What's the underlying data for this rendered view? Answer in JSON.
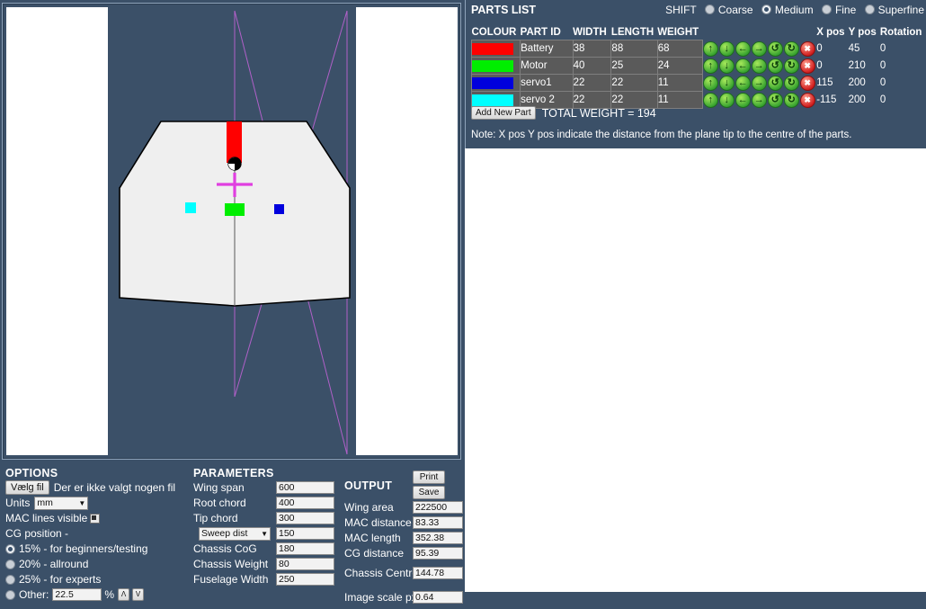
{
  "options": {
    "title": "OPTIONS",
    "file_button": "Vælg fil",
    "file_status": "Der er ikke valgt nogen fil",
    "units_label": "Units",
    "units_value": "mm",
    "mac_lines_label": "MAC lines visible",
    "cg_position_label": "CG position -",
    "cg_choices": [
      {
        "label": "15% - for beginners/testing",
        "selected": true
      },
      {
        "label": "20% - allround",
        "selected": false
      },
      {
        "label": "25% - for experts",
        "selected": false
      }
    ],
    "other_label": "Other:",
    "other_value": "22.5",
    "percent_sign": "%",
    "step_up": "Λ",
    "step_down": "V"
  },
  "parameters": {
    "title": "PARAMETERS",
    "rows": [
      {
        "label": "Wing span",
        "value": "600"
      },
      {
        "label": "Root chord",
        "value": "400"
      },
      {
        "label": "Tip chord",
        "value": "300"
      },
      {
        "label": "Sweep dist",
        "value": "150",
        "is_select": true
      },
      {
        "label": "Chassis CoG",
        "value": "180"
      },
      {
        "label": "Chassis Weight",
        "value": "80"
      },
      {
        "label": "Fuselage Width",
        "value": "250"
      }
    ]
  },
  "output": {
    "title": "OUTPUT",
    "print_label": "Print",
    "save_label": "Save",
    "rows": [
      {
        "label": "Wing area",
        "value": "222500"
      },
      {
        "label": "MAC distance",
        "value": "83.33"
      },
      {
        "label": "MAC length",
        "value": "352.38"
      },
      {
        "label": "CG distance",
        "value": "95.39"
      },
      {
        "label": "Chassis Centroid",
        "value": "144.78"
      },
      {
        "label": "Image scale px/unit",
        "value": "0.64"
      }
    ]
  },
  "parts_panel": {
    "title": "PARTS LIST",
    "shift_label": "SHIFT",
    "shift_options": [
      {
        "label": "Coarse",
        "selected": false
      },
      {
        "label": "Medium",
        "selected": true
      },
      {
        "label": "Fine",
        "selected": false
      },
      {
        "label": "Superfine",
        "selected": false
      }
    ],
    "columns": [
      "COLOUR",
      "PART ID",
      "WIDTH",
      "LENGTH",
      "WEIGHT",
      "X pos",
      "Y pos",
      "Rotation"
    ],
    "rows": [
      {
        "colour": "#ff0000",
        "part_id": "Battery",
        "width": "38",
        "length": "88",
        "weight": "68",
        "x_pos": "0",
        "y_pos": "45",
        "rotation": "0"
      },
      {
        "colour": "#00ee00",
        "part_id": "Motor",
        "width": "40",
        "length": "25",
        "weight": "24",
        "x_pos": "0",
        "y_pos": "210",
        "rotation": "0"
      },
      {
        "colour": "#0000dd",
        "part_id": "servo1",
        "width": "22",
        "length": "22",
        "weight": "11",
        "x_pos": "115",
        "y_pos": "200",
        "rotation": "0"
      },
      {
        "colour": "#00ffff",
        "part_id": "servo 2",
        "width": "22",
        "length": "22",
        "weight": "11",
        "x_pos": "-115",
        "y_pos": "200",
        "rotation": "0"
      }
    ],
    "row_icons": [
      "move-up",
      "move-down",
      "move-left",
      "move-right",
      "rotate-cw",
      "rotate-ccw",
      "delete"
    ],
    "row_icon_glyphs": [
      "⬆",
      "⬇",
      "⬅",
      "➡",
      "↺",
      "↻",
      "✖"
    ],
    "add_part_label": "Add New Part",
    "total_weight": "TOTAL WEIGHT = 194",
    "note": "Note: X pos Y pos indicate the distance from the plane tip to the centre of the parts."
  },
  "canvas": {
    "wing_fill": "#efefef",
    "wing_outline": "#000000",
    "mac_line_colour": "#b060c8",
    "cg_marker_colour": "#e03fe0",
    "centreline_colour": "#5a5a5a",
    "parts": [
      {
        "name": "battery",
        "colour": "#ff0000"
      },
      {
        "name": "motor",
        "colour": "#00ee00"
      },
      {
        "name": "servo1",
        "colour": "#0000dd"
      },
      {
        "name": "servo2",
        "colour": "#00ffff"
      }
    ]
  }
}
